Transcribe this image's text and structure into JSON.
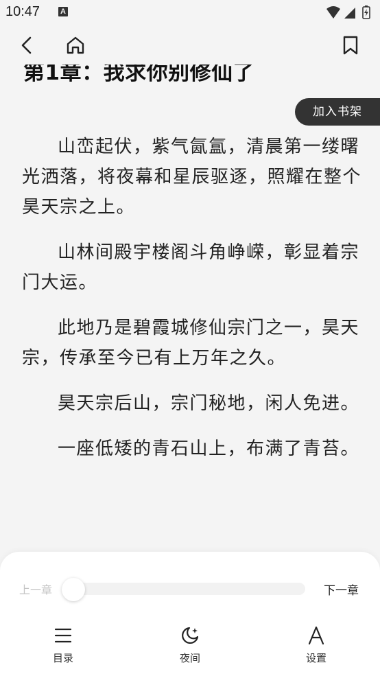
{
  "status_bar": {
    "time": "10:47",
    "notification_icon_letter": "A",
    "icons": [
      "wifi-icon",
      "signal-icon",
      "battery-icon"
    ]
  },
  "nav": {
    "icons": [
      "back-arrow-icon",
      "home-icon",
      "bookmark-icon"
    ]
  },
  "reader": {
    "chapter_title": "第1章：我求你别修仙了",
    "add_to_shelf_label": "加入书架",
    "paragraphs": [
      "山峦起伏，紫气氤氲，清晨第一缕曙光洒落，将夜幕和星辰驱逐，照耀在整个昊天宗之上。",
      "山林间殿宇楼阁斗角峥嵘，彰显着宗门大运。",
      "此地乃是碧霞城修仙宗门之一，昊天宗，传承至今已有上万年之久。",
      "昊天宗后山，宗门秘地，闲人免进。",
      "一座低矮的青石山上，布满了青苔。"
    ]
  },
  "bottom_panel": {
    "prev_chapter_label": "上一章",
    "next_chapter_label": "下一章",
    "progress_fraction": 0.0,
    "tabs": [
      {
        "label": "目录",
        "icon": "menu-list-icon"
      },
      {
        "label": "夜间",
        "icon": "moon-icon"
      },
      {
        "label": "设置",
        "icon": "font-a-icon"
      }
    ]
  },
  "colors": {
    "background": "#f4f4f4",
    "panel": "#ffffff",
    "button_dark": "#333333",
    "text": "#222222",
    "muted": "#c4c4c4"
  }
}
